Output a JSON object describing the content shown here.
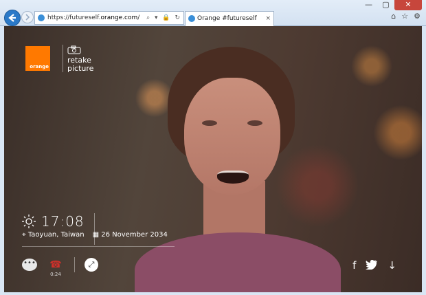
{
  "browser": {
    "url_prefix": "https://futureself.",
    "url_domain": "orange.com",
    "url_suffix": "/",
    "tab_title": "Orange #futureself",
    "tab_close": "×",
    "back_icon": "arrow-left-icon",
    "window_controls": [
      "—",
      "▢",
      "✕"
    ],
    "right_icons": [
      "home-icon",
      "star-icon",
      "gear-icon"
    ],
    "url_tools": "⌕ ▾ 🔒 ↻"
  },
  "page": {
    "logo_text": "orange",
    "retake_line1": "retake",
    "retake_line2": "picture",
    "time": "17:08",
    "location": "Taoyuan, Taiwan",
    "date": "26 November 2034",
    "call_duration": "0:24",
    "brand_color": "#ff7900"
  }
}
